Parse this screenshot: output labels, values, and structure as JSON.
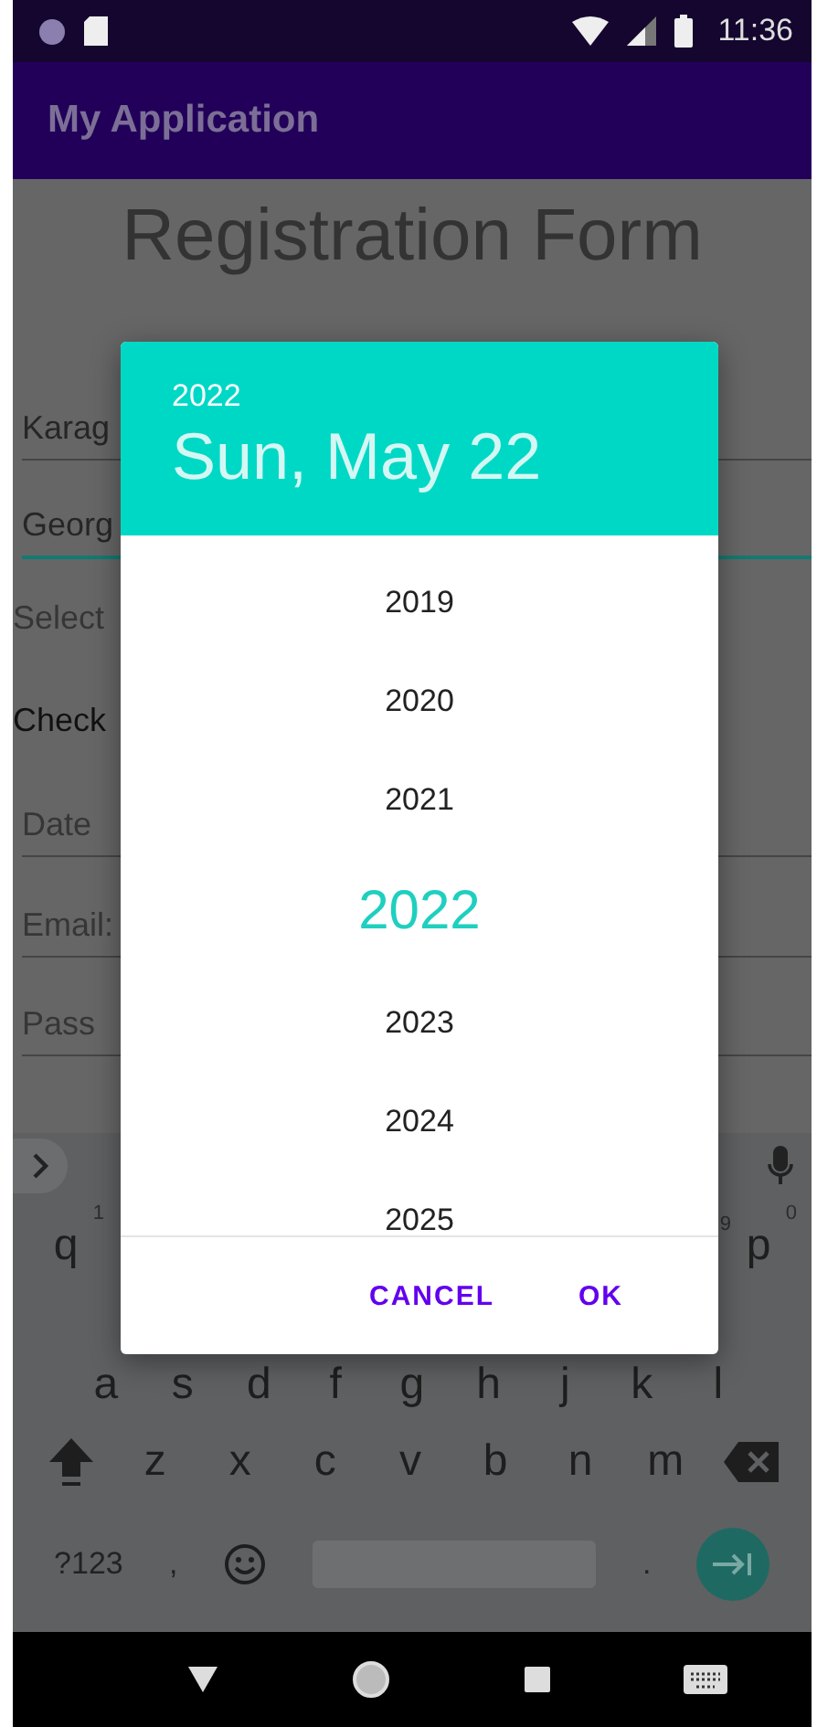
{
  "status_bar": {
    "time": "11:36"
  },
  "app_bar": {
    "title": "My Application"
  },
  "form": {
    "title": "Registration Form",
    "fields": [
      {
        "kind": "input",
        "value": "Karag",
        "focused": false
      },
      {
        "kind": "input",
        "value": "Georg",
        "focused": true
      },
      {
        "kind": "label",
        "text": "Select"
      },
      {
        "kind": "label",
        "text": "Check"
      },
      {
        "kind": "input",
        "placeholder": "Date",
        "focused": false
      },
      {
        "kind": "input",
        "placeholder": "Email:",
        "focused": false
      },
      {
        "kind": "input",
        "placeholder": "Pass",
        "focused": false
      }
    ]
  },
  "date_picker": {
    "header_year": "2022",
    "header_date": "Sun, May 22",
    "years": [
      {
        "label": "2019",
        "selected": false
      },
      {
        "label": "2020",
        "selected": false
      },
      {
        "label": "2021",
        "selected": false
      },
      {
        "label": "2022",
        "selected": true
      },
      {
        "label": "2023",
        "selected": false
      },
      {
        "label": "2024",
        "selected": false
      },
      {
        "label": "2025",
        "selected": false
      }
    ],
    "buttons": [
      "CANCEL",
      "OK"
    ]
  },
  "keyboard": {
    "row_1": [
      {
        "label": "q",
        "hint": "1"
      },
      {
        "hint": "9"
      },
      {
        "label": "p",
        "hint": "0"
      }
    ],
    "row_2": [
      "a",
      "s",
      "d",
      "f",
      "g",
      "h",
      "j",
      "k",
      "l"
    ],
    "row_3": [
      "z",
      "x",
      "c",
      "v",
      "b",
      "n",
      "m"
    ],
    "row_4": {
      "symbols": "?123",
      "comma": ",",
      "period": "."
    }
  }
}
